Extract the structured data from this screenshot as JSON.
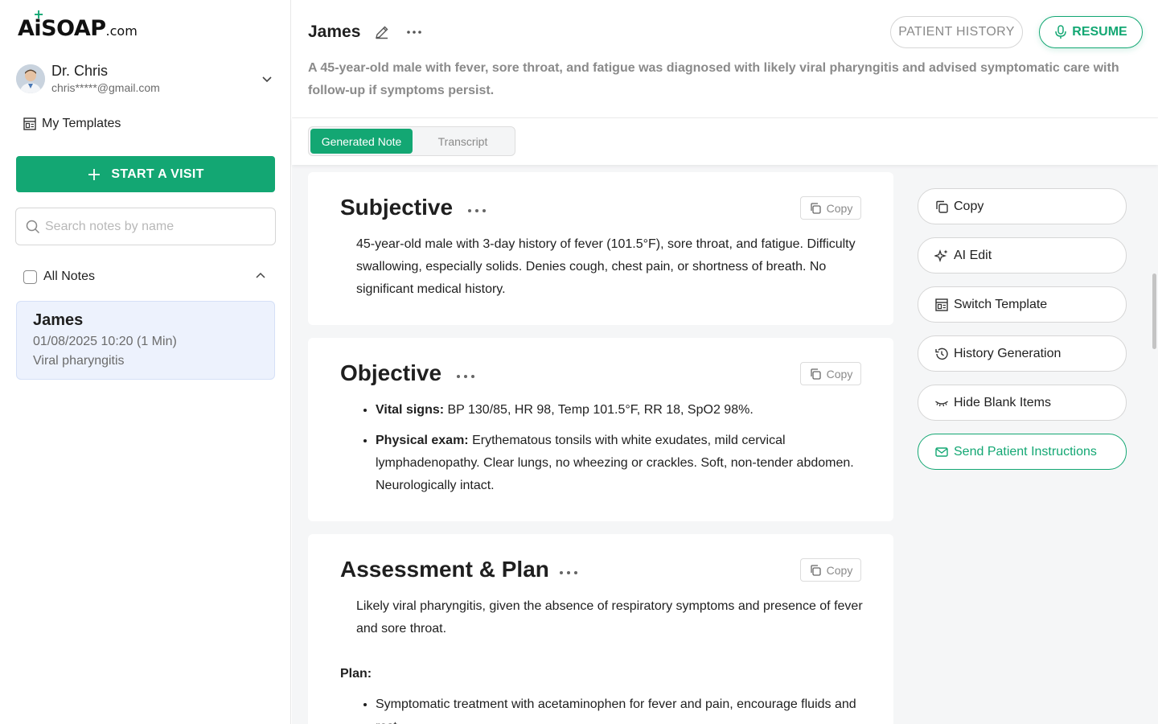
{
  "brand": {
    "logo_a": "A",
    "logo_i": "i",
    "logo_soap": "SOAP",
    "logo_com": ".com",
    "accent": "#13a773"
  },
  "user": {
    "name": "Dr. Chris",
    "email": "chris*****@gmail.com"
  },
  "sidebar": {
    "templates_label": "My Templates",
    "start_visit_label": "START A VISIT",
    "search_placeholder": "Search notes by name",
    "all_notes_label": "All Notes",
    "notes": [
      {
        "name": "James",
        "datetime": "01/08/2025 10:20 (1 Min)",
        "diagnosis": "Viral pharyngitis"
      }
    ]
  },
  "header": {
    "patient_name": "James",
    "patient_history_label": "PATIENT HISTORY",
    "resume_label": "RESUME",
    "summary": "A 45-year-old male with fever, sore throat, and fatigue was diagnosed with likely viral pharyngitis and advised symptomatic care with follow-up if symptoms persist."
  },
  "tabs": {
    "generated_note": "Generated Note",
    "transcript": "Transcript"
  },
  "note": {
    "copy_label": "Copy",
    "subjective": {
      "title": "Subjective",
      "text": "45-year-old male with 3-day history of fever (101.5°F), sore throat, and fatigue. Difficulty swallowing, especially solids. Denies cough, chest pain, or shortness of breath. No significant medical history."
    },
    "objective": {
      "title": "Objective",
      "items": [
        {
          "label": "Vital signs:",
          "text": " BP 130/85, HR 98, Temp 101.5°F, RR 18, SpO2 98%."
        },
        {
          "label": "Physical exam:",
          "text": " Erythematous tonsils with white exudates, mild cervical lymphadenopathy. Clear lungs, no wheezing or crackles. Soft, non-tender abdomen. Neurologically intact."
        }
      ]
    },
    "assessment": {
      "title": "Assessment & Plan",
      "text": "Likely viral pharyngitis, given the absence of respiratory symptoms and presence of fever and sore throat.",
      "plan_label": "Plan:",
      "plan_items": [
        "Symptomatic treatment with acetaminophen for fever and pain, encourage fluids and rest."
      ]
    }
  },
  "actions": {
    "copy": "Copy",
    "ai_edit": "AI Edit",
    "switch_template": "Switch Template",
    "history_generation": "History Generation",
    "hide_blank_items": "Hide Blank Items",
    "send_patient_instructions": "Send Patient Instructions"
  }
}
